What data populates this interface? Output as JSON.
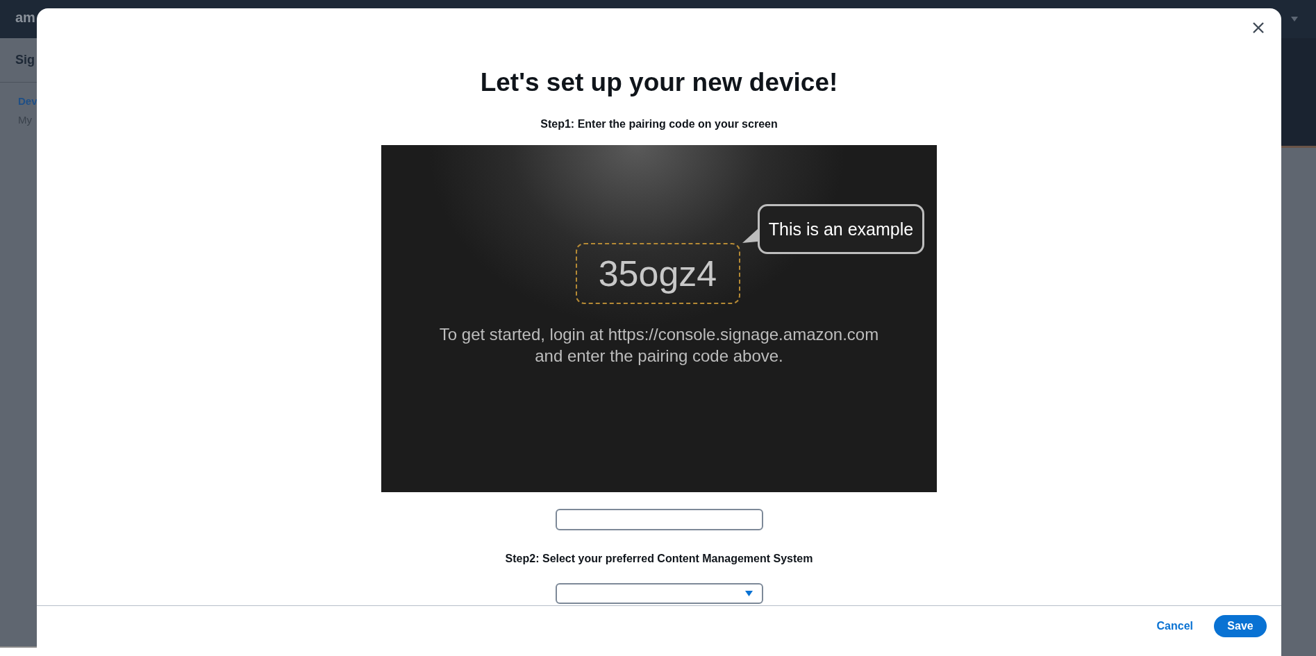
{
  "background": {
    "logo": "am",
    "page_title": "Sig",
    "breadcrumb_link": "Dev",
    "breadcrumb_text": "My"
  },
  "dialog": {
    "title": "Let's set up your new device!",
    "step1_label": "Step1: Enter the pairing code on your screen",
    "example_screen": {
      "callout": "This is an example",
      "pairing_code": "35ogz4",
      "instructions": [
        "To get started, login at https://console.signage.amazon.com",
        "and enter the pairing code above."
      ]
    },
    "step2_label": "Step2: Select your preferred Content Management System",
    "buttons": [
      {
        "label": "Cancel",
        "kind": "link"
      },
      {
        "label": "Save",
        "kind": "primary"
      }
    ]
  }
}
